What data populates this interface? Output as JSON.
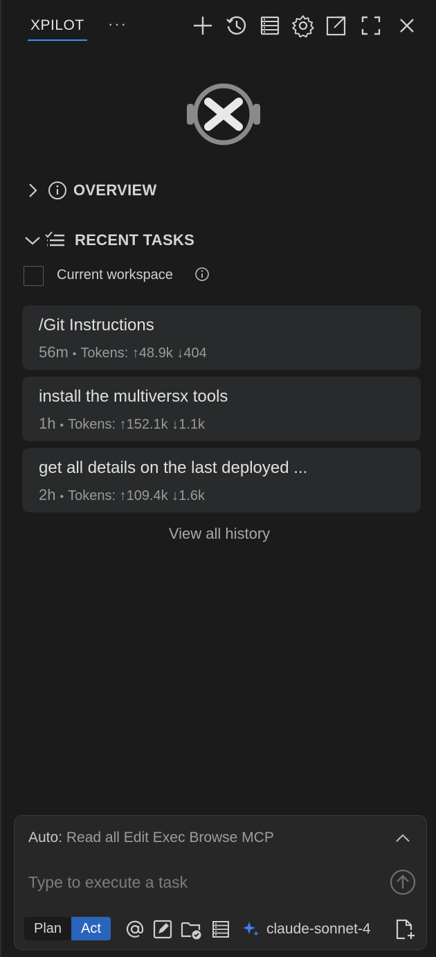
{
  "header": {
    "title": "XPILOT",
    "more": "···",
    "icons": [
      "plus-icon",
      "history-icon",
      "server-icon",
      "gear-icon",
      "open-external-icon",
      "fullscreen-icon",
      "close-icon"
    ]
  },
  "overview": {
    "title": "OVERVIEW"
  },
  "recent": {
    "title": "RECENT TASKS",
    "workspace_filter": "Current workspace",
    "tasks": [
      {
        "title": "/Git Instructions",
        "age": "56m",
        "tokens": "Tokens: ↑48.9k ↓404"
      },
      {
        "title": "install the multiversx tools",
        "age": "1h",
        "tokens": "Tokens: ↑152.1k ↓1.1k"
      },
      {
        "title": "get all details on the last deployed ...",
        "age": "2h",
        "tokens": "Tokens: ↑109.4k ↓1.6k"
      }
    ],
    "view_all": "View all history"
  },
  "composer": {
    "auto_label": "Auto:",
    "auto_permissions": "Read all Edit Exec Browse MCP",
    "placeholder": "Type to execute a task",
    "mode_plan": "Plan",
    "mode_act": "Act",
    "active_mode": "Act",
    "model": "claude-sonnet-4",
    "accent": "#2a65bd"
  }
}
